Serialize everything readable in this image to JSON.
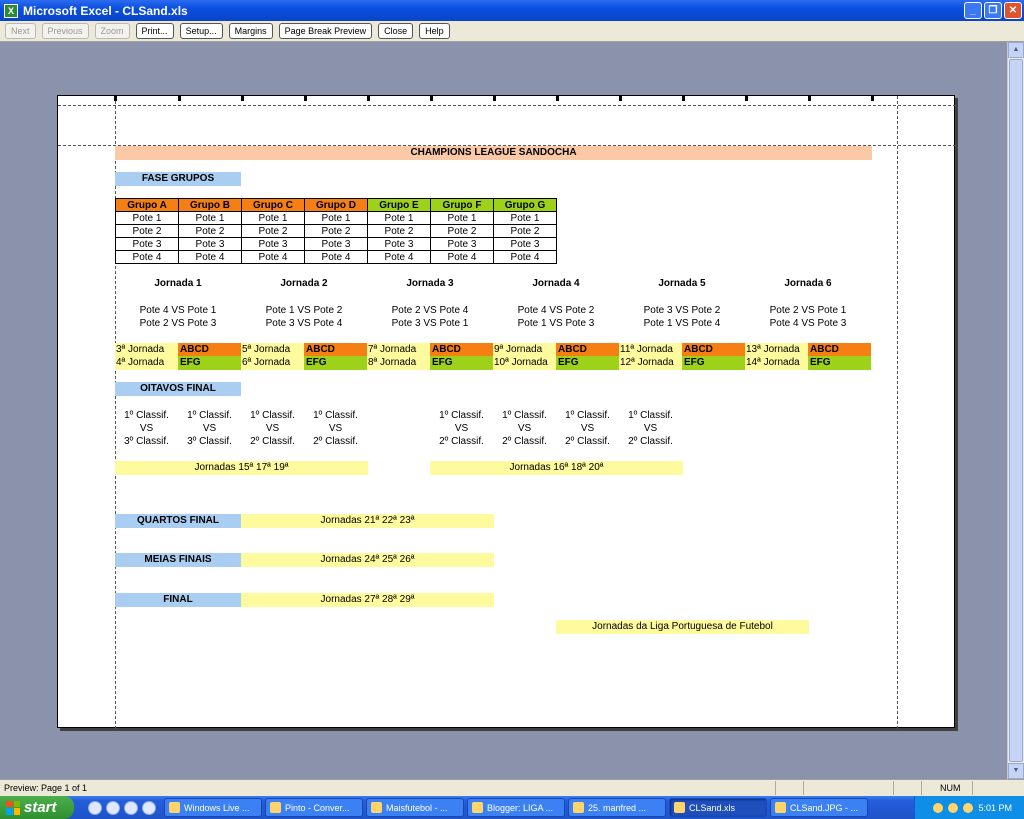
{
  "window": {
    "title": "Microsoft Excel - CLSand.xls",
    "icon": "excel-icon"
  },
  "toolbar": {
    "buttons": [
      {
        "label": "Next",
        "enabled": false
      },
      {
        "label": "Previous",
        "enabled": false
      },
      {
        "label": "Zoom",
        "enabled": false
      },
      {
        "label": "Print...",
        "enabled": true
      },
      {
        "label": "Setup...",
        "enabled": true
      },
      {
        "label": "Margins",
        "enabled": true
      },
      {
        "label": "Page Break Preview",
        "enabled": true
      },
      {
        "label": "Close",
        "enabled": true
      },
      {
        "label": "Help",
        "enabled": true
      }
    ]
  },
  "sheet": {
    "title": "CHAMPIONS LEAGUE SANDOCHA",
    "fase_grupos": "FASE GRUPOS",
    "groups": [
      "Grupo A",
      "Grupo B",
      "Grupo C",
      "Grupo D",
      "Grupo E",
      "Grupo F",
      "Grupo G"
    ],
    "potes": [
      "Pote 1",
      "Pote 2",
      "Pote 3",
      "Pote 4"
    ],
    "jornadas": [
      {
        "name": "Jornada 1",
        "m1": "Pote 4 VS Pote 1",
        "m2": "Pote 2 VS Pote 3",
        "r1": "3ª Jornada",
        "r2": "4ª Jornada"
      },
      {
        "name": "Jornada 2",
        "m1": "Pote 1 VS Pote 2",
        "m2": "Pote 3 VS Pote 4",
        "r1": "5ª Jornada",
        "r2": "6ª Jornada"
      },
      {
        "name": "Jornada 3",
        "m1": "Pote 2 VS Pote 4",
        "m2": "Pote 3 VS Pote 1",
        "r1": "7ª Jornada",
        "r2": "8ª Jornada"
      },
      {
        "name": "Jornada 4",
        "m1": "Pote 4 VS Pote 2",
        "m2": "Pote 1 VS Pote 3",
        "r1": "9ª Jornada",
        "r2": "10ª Jornada"
      },
      {
        "name": "Jornada 5",
        "m1": "Pote 3 VS Pote 2",
        "m2": "Pote 1 VS Pote 4",
        "r1": "11ª Jornada",
        "r2": "12ª Jornada"
      },
      {
        "name": "Jornada 6",
        "m1": "Pote 2 VS Pote 1",
        "m2": "Pote 4 VS Pote 3",
        "r1": "13ª Jornada",
        "r2": "14ª Jornada"
      }
    ],
    "tag_abcd": "ABCD",
    "tag_efg": "EFG",
    "oitavos": "OITAVOS FINAL",
    "ko_top": "1º Classif.",
    "ko_vs": "VS",
    "ko_bottoms": [
      "3º Classif.",
      "3º Classif.",
      "2º Classif.",
      "2º Classif.",
      "2º Classif.",
      "2º Classif.",
      "2º Classif.",
      "2º Classif."
    ],
    "oitavos_j1": "Jornadas 15ª 17ª 19ª",
    "oitavos_j2": "Jornadas 16ª 18ª 20ª",
    "quartos": "QUARTOS FINAL",
    "quartos_j": "Jornadas 21ª 22ª 23ª",
    "meias": "MEIAS FINAIS",
    "meias_j": "Jornadas 24ª 25ª 26ª",
    "final": "FINAL",
    "final_j": "Jornadas 27ª 28ª 29ª",
    "legend": "Jornadas da Liga Portuguesa de Futebol"
  },
  "status": {
    "text": "Preview: Page 1 of 1",
    "num": "NUM"
  },
  "taskbar": {
    "start": "start",
    "tasks": [
      "Windows Live ...",
      "Pinto - Conver...",
      "Maisfutebol - ...",
      "Blogger: LIGA ...",
      "25. manfred ...",
      "CLSand.xls",
      "CLSand.JPG - ..."
    ],
    "active": "CLSand.xls",
    "clock": "5:01 PM"
  }
}
